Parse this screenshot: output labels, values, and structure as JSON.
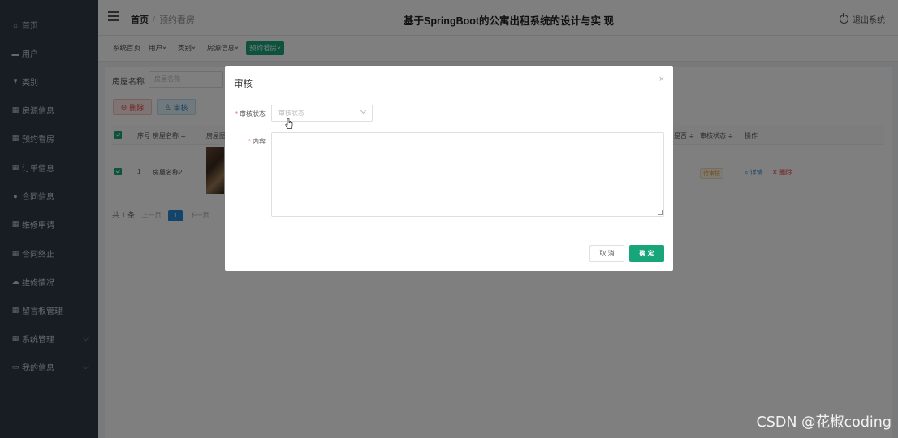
{
  "sidebar": {
    "items": [
      {
        "label": "首页",
        "icon": "home-icon"
      },
      {
        "label": "用户",
        "icon": "user-card-icon"
      },
      {
        "label": "类别",
        "icon": "tag-icon"
      },
      {
        "label": "房源信息",
        "icon": "grid-icon"
      },
      {
        "label": "预约看房",
        "icon": "grid-icon"
      },
      {
        "label": "订单信息",
        "icon": "grid-icon"
      },
      {
        "label": "合同信息",
        "icon": "person-icon"
      },
      {
        "label": "维修申请",
        "icon": "grid-icon"
      },
      {
        "label": "合同终止",
        "icon": "grid-icon"
      },
      {
        "label": "维修情况",
        "icon": "cloud-icon"
      },
      {
        "label": "留言板管理",
        "icon": "grid-icon"
      },
      {
        "label": "系统管理",
        "icon": "grid-icon"
      },
      {
        "label": "我的信息",
        "icon": "monitor-icon"
      }
    ]
  },
  "topbar": {
    "breadcrumb_home": "首页",
    "breadcrumb_sep": "/",
    "breadcrumb_current": "预约看房",
    "title": "基于SpringBoot的公寓出租系统的设计与实 现",
    "logout": "退出系统"
  },
  "tabs": [
    "系统首页",
    "用户×",
    "类别×",
    "房源信息×",
    "预约看房×"
  ],
  "search": {
    "label": "房屋名称",
    "placeholder": "房屋名称"
  },
  "buttons": {
    "delete": "删除",
    "audit": "审核"
  },
  "table": {
    "headers": [
      "序号",
      "房屋名称 ≑",
      "房屋图",
      "",
      "审核状态 ≑",
      "操作"
    ],
    "header_partial": "是否 ≑",
    "row": {
      "index": "1",
      "name": "房屋名称2",
      "status": "待审核",
      "detail": "详情",
      "delete": "删除"
    }
  },
  "pagination": {
    "total": "共 1 条",
    "prev": "上一页",
    "page": "1",
    "next": "下一页"
  },
  "dialog": {
    "title": "审核",
    "close": "×",
    "status_label": "审核状态",
    "status_placeholder": "审核状态",
    "content_label": "内容",
    "required_mark": "*",
    "cancel": "取 消",
    "confirm": "确 定"
  },
  "watermark": "CSDN @花椒coding",
  "colors": {
    "sidebar_bg": "#2f3a47",
    "accent": "#19a57a",
    "overlay": "rgba(0,0,0,0.5)"
  }
}
